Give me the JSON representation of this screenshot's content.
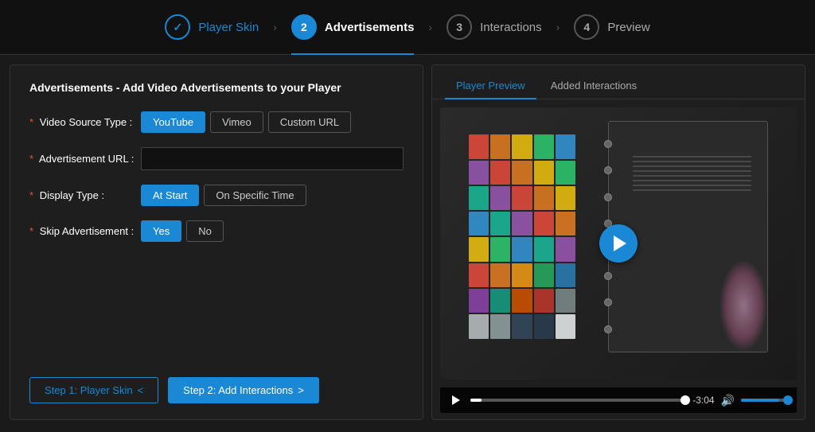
{
  "stepper": {
    "steps": [
      {
        "id": "player-skin",
        "number": "✓",
        "label": "Player Skin",
        "state": "done"
      },
      {
        "id": "advertisements",
        "number": "2",
        "label": "Advertisements",
        "state": "active"
      },
      {
        "id": "interactions",
        "number": "3",
        "label": "Interactions",
        "state": "inactive"
      },
      {
        "id": "preview",
        "number": "4",
        "label": "Preview",
        "state": "inactive"
      }
    ]
  },
  "left_panel": {
    "title": "Advertisements - Add Video Advertisements to your Player",
    "video_source": {
      "label": "Video Source Type :",
      "options": [
        "YouTube",
        "Vimeo",
        "Custom URL"
      ],
      "selected": "YouTube"
    },
    "ad_url": {
      "label": "Advertisement URL :",
      "placeholder": "",
      "value": ""
    },
    "display_type": {
      "label": "Display Type :",
      "options": [
        "At Start",
        "On Specific Time"
      ],
      "selected": "At Start"
    },
    "skip_ad": {
      "label": "Skip Advertisement :",
      "options": [
        "Yes",
        "No"
      ],
      "selected": "Yes"
    },
    "nav": {
      "step1_label": "Step 1: Player Skin",
      "step1_arrow": "<",
      "step2_label": "Step 2: Add Interactions",
      "step2_arrow": ">"
    }
  },
  "right_panel": {
    "tabs": [
      {
        "id": "player-preview",
        "label": "Player Preview",
        "active": true
      },
      {
        "id": "added-interactions",
        "label": "Added Interactions",
        "active": false
      }
    ],
    "video": {
      "time": "-3:04"
    }
  },
  "icons": {
    "arrow_right": "›",
    "checkmark": "✓",
    "play": "▶",
    "volume": "🔊"
  }
}
